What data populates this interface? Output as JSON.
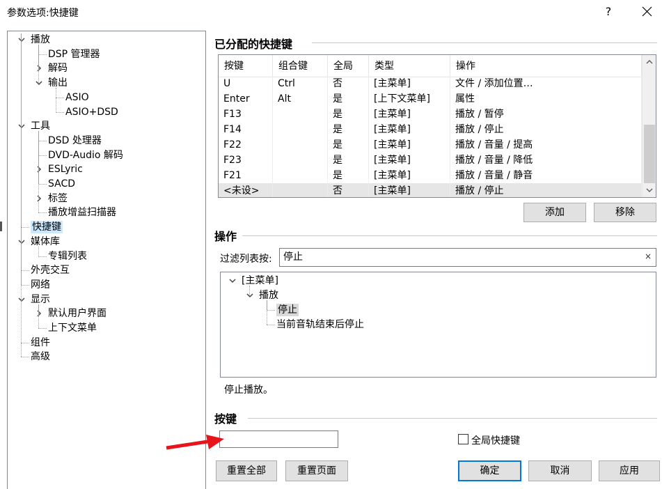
{
  "window": {
    "title": "参数选项:快捷键",
    "help_glyph": "?",
    "close_label": "close"
  },
  "tree": {
    "nodes": [
      {
        "label": "播放",
        "level": 0,
        "expander": "down"
      },
      {
        "label": "DSP 管理器",
        "level": 1,
        "expander": ""
      },
      {
        "label": "解码",
        "level": 1,
        "expander": "right"
      },
      {
        "label": "输出",
        "level": 1,
        "expander": "down"
      },
      {
        "label": "ASIO",
        "level": 2,
        "expander": ""
      },
      {
        "label": "ASIO+DSD",
        "level": 2,
        "expander": ""
      },
      {
        "label": "工具",
        "level": 0,
        "expander": "down"
      },
      {
        "label": "DSD 处理器",
        "level": 1,
        "expander": ""
      },
      {
        "label": "DVD-Audio 解码",
        "level": 1,
        "expander": ""
      },
      {
        "label": "ESLyric",
        "level": 1,
        "expander": "right"
      },
      {
        "label": "SACD",
        "level": 1,
        "expander": ""
      },
      {
        "label": "标签",
        "level": 1,
        "expander": "right"
      },
      {
        "label": "播放增益扫描器",
        "level": 1,
        "expander": ""
      },
      {
        "label": "快捷键",
        "level": 0,
        "expander": "",
        "selected": true
      },
      {
        "label": "媒体库",
        "level": 0,
        "expander": "down"
      },
      {
        "label": "专辑列表",
        "level": 1,
        "expander": ""
      },
      {
        "label": "外壳交互",
        "level": 0,
        "expander": ""
      },
      {
        "label": "网络",
        "level": 0,
        "expander": ""
      },
      {
        "label": "显示",
        "level": 0,
        "expander": "down"
      },
      {
        "label": "默认用户界面",
        "level": 1,
        "expander": "right"
      },
      {
        "label": "上下文菜单",
        "level": 1,
        "expander": ""
      },
      {
        "label": "组件",
        "level": 0,
        "expander": ""
      },
      {
        "label": "高级",
        "level": 0,
        "expander": ""
      }
    ]
  },
  "assigned": {
    "title": "已分配的快捷键",
    "columns": [
      "按键",
      "组合键",
      "全局",
      "类型",
      "操作"
    ],
    "rows": [
      [
        "U",
        "Ctrl",
        "否",
        "[主菜单]",
        "文件 / 添加位置…"
      ],
      [
        "Enter",
        "Alt",
        "是",
        "[上下文菜单]",
        "属性"
      ],
      [
        "F13",
        "",
        "是",
        "[主菜单]",
        "播放 / 暂停"
      ],
      [
        "F14",
        "",
        "是",
        "[主菜单]",
        "播放 / 停止"
      ],
      [
        "F22",
        "",
        "是",
        "[主菜单]",
        "播放 / 音量 / 提高"
      ],
      [
        "F23",
        "",
        "是",
        "[主菜单]",
        "播放 / 音量 / 降低"
      ],
      [
        "F21",
        "",
        "是",
        "[主菜单]",
        "播放 / 音量 / 静音"
      ],
      [
        "<未设>",
        "",
        "否",
        "[主菜单]",
        "播放 / 停止"
      ]
    ],
    "selected_row": 7,
    "add_label": "添加",
    "remove_label": "移除"
  },
  "action": {
    "title": "操作",
    "filter_label": "过滤列表按:",
    "filter_value": "停止",
    "clear_glyph": "×",
    "tree": [
      {
        "label": "[主菜单]",
        "level": 0,
        "expander": "down"
      },
      {
        "label": "播放",
        "level": 1,
        "expander": "down"
      },
      {
        "label": "停止",
        "level": 2,
        "expander": "",
        "selected": true
      },
      {
        "label": "当前音轨结束后停止",
        "level": 2,
        "expander": ""
      }
    ],
    "description": "停止播放。"
  },
  "key": {
    "title": "按键",
    "value": "",
    "global_label": "全局快捷键",
    "global_checked": false
  },
  "buttons": {
    "reset_all": "重置全部",
    "reset_page": "重置页面",
    "ok": "确定",
    "cancel": "取消",
    "apply": "应用"
  },
  "colors": {
    "selection": "#cce8ff",
    "default_button_border": "#0078d7",
    "arrow": "#e8141b"
  }
}
